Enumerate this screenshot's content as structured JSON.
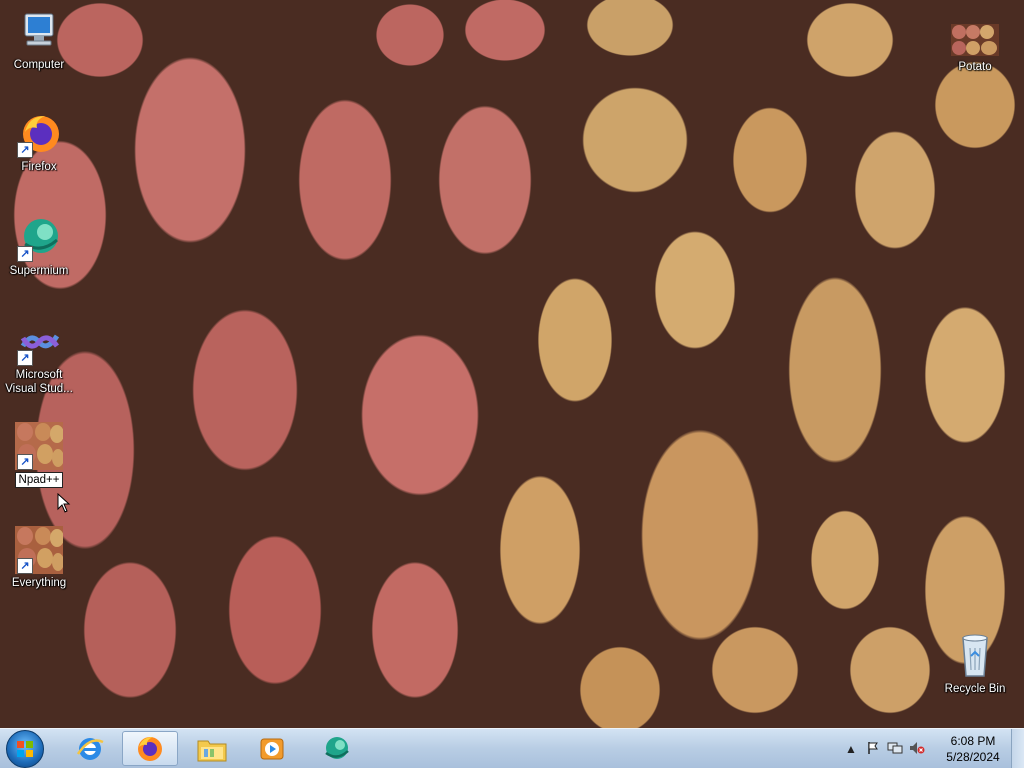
{
  "desktop": {
    "icons": [
      {
        "label": "Computer"
      },
      {
        "label": "Firefox"
      },
      {
        "label": "Supermium"
      },
      {
        "label": "Microsoft Visual Stud..."
      },
      {
        "label": "Npad++"
      },
      {
        "label": "Everything"
      },
      {
        "label": "Potato"
      },
      {
        "label": "Recycle Bin"
      }
    ]
  },
  "taskbar": {
    "pinned": [
      {
        "name": "Internet Explorer",
        "icon": "ie-icon"
      },
      {
        "name": "Firefox",
        "icon": "firefox-icon",
        "active": true
      },
      {
        "name": "Windows Explorer",
        "icon": "folder-icon"
      },
      {
        "name": "Windows Media Player",
        "icon": "media-player-icon"
      },
      {
        "name": "Supermium",
        "icon": "supermium-icon"
      }
    ],
    "tray": {
      "time": "6:08 PM",
      "date": "5/28/2024"
    }
  },
  "colors": {
    "taskbar_top": "#d3e3f3",
    "taskbar_bottom": "#a9c0dc",
    "start_orb": "#1d6bb8"
  }
}
